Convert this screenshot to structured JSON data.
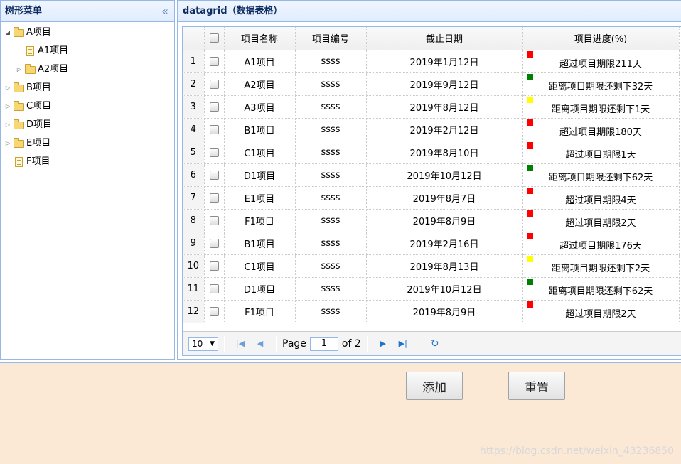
{
  "tree_panel": {
    "title": "树形菜单",
    "collapse_glyph": "«",
    "nodes": [
      {
        "label": "A项目",
        "depth": 0,
        "toggle": "◢",
        "type": "folder"
      },
      {
        "label": "A1项目",
        "depth": 1,
        "toggle": "",
        "type": "file"
      },
      {
        "label": "A2项目",
        "depth": 1,
        "toggle": "▷",
        "type": "folder"
      },
      {
        "label": "B项目",
        "depth": 0,
        "toggle": "▷",
        "type": "folder"
      },
      {
        "label": "C项目",
        "depth": 0,
        "toggle": "▷",
        "type": "folder"
      },
      {
        "label": "D项目",
        "depth": 0,
        "toggle": "▷",
        "type": "folder"
      },
      {
        "label": "E项目",
        "depth": 0,
        "toggle": "▷",
        "type": "folder"
      },
      {
        "label": "F项目",
        "depth": 0,
        "toggle": "",
        "type": "file"
      }
    ]
  },
  "grid_panel": {
    "title": "datagrid（数据表格）",
    "columns": [
      "项目名称",
      "项目编号",
      "截止日期",
      "项目进度(%)"
    ],
    "rows": [
      {
        "num": "1",
        "name": "A1项目",
        "code": "ssss",
        "date": "2019年1月12日",
        "status": "red",
        "progress": "超过项目期限211天"
      },
      {
        "num": "2",
        "name": "A2项目",
        "code": "ssss",
        "date": "2019年9月12日",
        "status": "green",
        "progress": "距离项目期限还剩下32天"
      },
      {
        "num": "3",
        "name": "A3项目",
        "code": "ssss",
        "date": "2019年8月12日",
        "status": "yellow",
        "progress": "距离项目期限还剩下1天"
      },
      {
        "num": "4",
        "name": "B1项目",
        "code": "ssss",
        "date": "2019年2月12日",
        "status": "red",
        "progress": "超过项目期限180天"
      },
      {
        "num": "5",
        "name": "C1项目",
        "code": "ssss",
        "date": "2019年8月10日",
        "status": "red",
        "progress": "超过项目期限1天"
      },
      {
        "num": "6",
        "name": "D1项目",
        "code": "ssss",
        "date": "2019年10月12日",
        "status": "green",
        "progress": "距离项目期限还剩下62天"
      },
      {
        "num": "7",
        "name": "E1项目",
        "code": "ssss",
        "date": "2019年8月7日",
        "status": "red",
        "progress": "超过项目期限4天"
      },
      {
        "num": "8",
        "name": "F1项目",
        "code": "ssss",
        "date": "2019年8月9日",
        "status": "red",
        "progress": "超过项目期限2天"
      },
      {
        "num": "9",
        "name": "B1项目",
        "code": "ssss",
        "date": "2019年2月16日",
        "status": "red",
        "progress": "超过项目期限176天"
      },
      {
        "num": "10",
        "name": "C1项目",
        "code": "ssss",
        "date": "2019年8月13日",
        "status": "yellow",
        "progress": "距离项目期限还剩下2天"
      },
      {
        "num": "11",
        "name": "D1项目",
        "code": "ssss",
        "date": "2019年10月12日",
        "status": "green",
        "progress": "距离项目期限还剩下62天"
      },
      {
        "num": "12",
        "name": "F1项目",
        "code": "ssss",
        "date": "2019年8月9日",
        "status": "red",
        "progress": "超过项目期限2天"
      }
    ],
    "status_colors": {
      "red": "#ff0000",
      "green": "#008000",
      "yellow": "#ffff00"
    }
  },
  "pager": {
    "page_size": "10",
    "page_label": "Page",
    "current_page": "1",
    "of_label": "of 2"
  },
  "form": {
    "add_label": "添加",
    "reset_label": "重置"
  },
  "watermark": "https://blog.csdn.net/weixin_43236850"
}
